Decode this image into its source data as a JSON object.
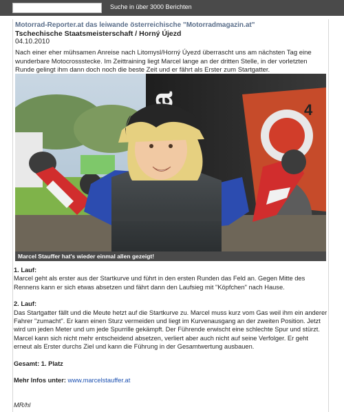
{
  "search": {
    "input_value": "",
    "label": "Suche in über 3000 Berichten"
  },
  "article": {
    "site_line": "Motorrad-Reporter.at das leiwande österreichische \"Motorradmagazin.at\"",
    "title": "Tschechische Staatsmeisterschaft / Horný Újezd",
    "date": "04.10.2010",
    "intro": "Nach einer eher mühsamen Anreise nach Litomysl/Horný Úyezd überrascht uns am nächsten Tag eine wunderbare Motocrossstecke. Im Zeittraining liegt Marcel lange an der dritten Stelle, in der vorletzten Runde gelingt ihm dann doch noch die beste Zeit und er fährt als Erster zum Startgatter.",
    "photo_caption": "Marcel Stauffer hat's wieder einmal allen gezeigt!",
    "race1_heading": "1. Lauf:",
    "race1_text": "Marcel geht als erster aus der Startkurve und führt in den ersten Runden das Feld an. Gegen Mitte des Rennens kann er sich etwas absetzen und fährt dann den Laufsieg mit \"Köpfchen\" nach Hause.",
    "race2_heading": "2. Lauf:",
    "race2_text": "Das Startgatter fällt und die Meute hetzt auf die Startkurve zu. Marcel muss kurz vom Gas weil ihm ein anderer Fahrer \"zumacht\". Er kann einen Sturz vermeiden und liegt im Kurvenausgang an der zweiten Position. Jetzt wird um jeden Meter und um jede Spurrille gekämpft. Der Führende erwischt eine schlechte Spur und stürzt. Marcel kann sich nicht mehr entscheidend absetzen, verliert aber auch nicht auf seine Verfolger. Er geht erneut als Erster durchs Ziel und kann die Führung in der Gesamtwertung ausbauen.",
    "total": "Gesamt: 1. Platz",
    "more_info_label": "Mehr Infos unter:",
    "more_info_link": "www.marcelstauffer.at",
    "signature": "MR/hl"
  },
  "colors": {
    "topbar": "#4a4a4a",
    "site_line": "#5a6e8a",
    "link": "#1a4fb0"
  }
}
